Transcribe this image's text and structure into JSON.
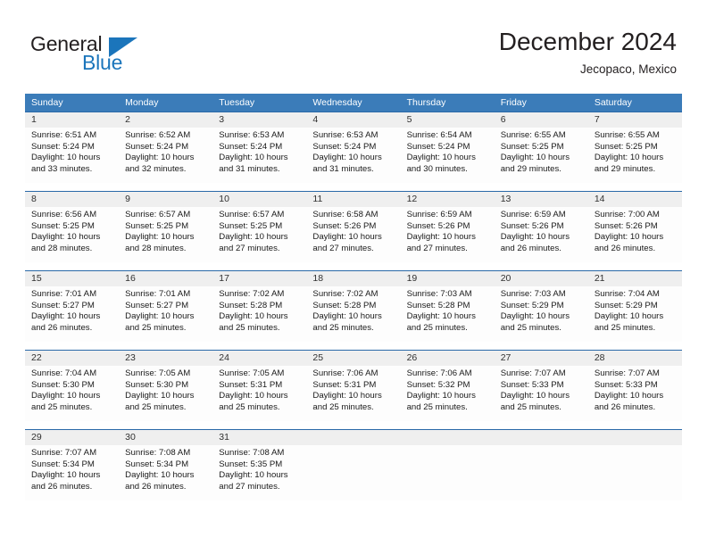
{
  "logo": {
    "part1": "General",
    "part2": "Blue",
    "triangle_color": "#1b75bb"
  },
  "header": {
    "title": "December 2024",
    "subtitle": "Jecopaco, Mexico"
  },
  "theme": {
    "header_row_bg": "#3b7cb9",
    "cell_top_border": "#2a69a8",
    "daynum_band_bg": "#efefef"
  },
  "weekdays": [
    "Sunday",
    "Monday",
    "Tuesday",
    "Wednesday",
    "Thursday",
    "Friday",
    "Saturday"
  ],
  "weeks": [
    [
      {
        "day": "1",
        "sunrise": "Sunrise: 6:51 AM",
        "sunset": "Sunset: 5:24 PM",
        "daylight1": "Daylight: 10 hours",
        "daylight2": "and 33 minutes."
      },
      {
        "day": "2",
        "sunrise": "Sunrise: 6:52 AM",
        "sunset": "Sunset: 5:24 PM",
        "daylight1": "Daylight: 10 hours",
        "daylight2": "and 32 minutes."
      },
      {
        "day": "3",
        "sunrise": "Sunrise: 6:53 AM",
        "sunset": "Sunset: 5:24 PM",
        "daylight1": "Daylight: 10 hours",
        "daylight2": "and 31 minutes."
      },
      {
        "day": "4",
        "sunrise": "Sunrise: 6:53 AM",
        "sunset": "Sunset: 5:24 PM",
        "daylight1": "Daylight: 10 hours",
        "daylight2": "and 31 minutes."
      },
      {
        "day": "5",
        "sunrise": "Sunrise: 6:54 AM",
        "sunset": "Sunset: 5:24 PM",
        "daylight1": "Daylight: 10 hours",
        "daylight2": "and 30 minutes."
      },
      {
        "day": "6",
        "sunrise": "Sunrise: 6:55 AM",
        "sunset": "Sunset: 5:25 PM",
        "daylight1": "Daylight: 10 hours",
        "daylight2": "and 29 minutes."
      },
      {
        "day": "7",
        "sunrise": "Sunrise: 6:55 AM",
        "sunset": "Sunset: 5:25 PM",
        "daylight1": "Daylight: 10 hours",
        "daylight2": "and 29 minutes."
      }
    ],
    [
      {
        "day": "8",
        "sunrise": "Sunrise: 6:56 AM",
        "sunset": "Sunset: 5:25 PM",
        "daylight1": "Daylight: 10 hours",
        "daylight2": "and 28 minutes."
      },
      {
        "day": "9",
        "sunrise": "Sunrise: 6:57 AM",
        "sunset": "Sunset: 5:25 PM",
        "daylight1": "Daylight: 10 hours",
        "daylight2": "and 28 minutes."
      },
      {
        "day": "10",
        "sunrise": "Sunrise: 6:57 AM",
        "sunset": "Sunset: 5:25 PM",
        "daylight1": "Daylight: 10 hours",
        "daylight2": "and 27 minutes."
      },
      {
        "day": "11",
        "sunrise": "Sunrise: 6:58 AM",
        "sunset": "Sunset: 5:26 PM",
        "daylight1": "Daylight: 10 hours",
        "daylight2": "and 27 minutes."
      },
      {
        "day": "12",
        "sunrise": "Sunrise: 6:59 AM",
        "sunset": "Sunset: 5:26 PM",
        "daylight1": "Daylight: 10 hours",
        "daylight2": "and 27 minutes."
      },
      {
        "day": "13",
        "sunrise": "Sunrise: 6:59 AM",
        "sunset": "Sunset: 5:26 PM",
        "daylight1": "Daylight: 10 hours",
        "daylight2": "and 26 minutes."
      },
      {
        "day": "14",
        "sunrise": "Sunrise: 7:00 AM",
        "sunset": "Sunset: 5:26 PM",
        "daylight1": "Daylight: 10 hours",
        "daylight2": "and 26 minutes."
      }
    ],
    [
      {
        "day": "15",
        "sunrise": "Sunrise: 7:01 AM",
        "sunset": "Sunset: 5:27 PM",
        "daylight1": "Daylight: 10 hours",
        "daylight2": "and 26 minutes."
      },
      {
        "day": "16",
        "sunrise": "Sunrise: 7:01 AM",
        "sunset": "Sunset: 5:27 PM",
        "daylight1": "Daylight: 10 hours",
        "daylight2": "and 25 minutes."
      },
      {
        "day": "17",
        "sunrise": "Sunrise: 7:02 AM",
        "sunset": "Sunset: 5:28 PM",
        "daylight1": "Daylight: 10 hours",
        "daylight2": "and 25 minutes."
      },
      {
        "day": "18",
        "sunrise": "Sunrise: 7:02 AM",
        "sunset": "Sunset: 5:28 PM",
        "daylight1": "Daylight: 10 hours",
        "daylight2": "and 25 minutes."
      },
      {
        "day": "19",
        "sunrise": "Sunrise: 7:03 AM",
        "sunset": "Sunset: 5:28 PM",
        "daylight1": "Daylight: 10 hours",
        "daylight2": "and 25 minutes."
      },
      {
        "day": "20",
        "sunrise": "Sunrise: 7:03 AM",
        "sunset": "Sunset: 5:29 PM",
        "daylight1": "Daylight: 10 hours",
        "daylight2": "and 25 minutes."
      },
      {
        "day": "21",
        "sunrise": "Sunrise: 7:04 AM",
        "sunset": "Sunset: 5:29 PM",
        "daylight1": "Daylight: 10 hours",
        "daylight2": "and 25 minutes."
      }
    ],
    [
      {
        "day": "22",
        "sunrise": "Sunrise: 7:04 AM",
        "sunset": "Sunset: 5:30 PM",
        "daylight1": "Daylight: 10 hours",
        "daylight2": "and 25 minutes."
      },
      {
        "day": "23",
        "sunrise": "Sunrise: 7:05 AM",
        "sunset": "Sunset: 5:30 PM",
        "daylight1": "Daylight: 10 hours",
        "daylight2": "and 25 minutes."
      },
      {
        "day": "24",
        "sunrise": "Sunrise: 7:05 AM",
        "sunset": "Sunset: 5:31 PM",
        "daylight1": "Daylight: 10 hours",
        "daylight2": "and 25 minutes."
      },
      {
        "day": "25",
        "sunrise": "Sunrise: 7:06 AM",
        "sunset": "Sunset: 5:31 PM",
        "daylight1": "Daylight: 10 hours",
        "daylight2": "and 25 minutes."
      },
      {
        "day": "26",
        "sunrise": "Sunrise: 7:06 AM",
        "sunset": "Sunset: 5:32 PM",
        "daylight1": "Daylight: 10 hours",
        "daylight2": "and 25 minutes."
      },
      {
        "day": "27",
        "sunrise": "Sunrise: 7:07 AM",
        "sunset": "Sunset: 5:33 PM",
        "daylight1": "Daylight: 10 hours",
        "daylight2": "and 25 minutes."
      },
      {
        "day": "28",
        "sunrise": "Sunrise: 7:07 AM",
        "sunset": "Sunset: 5:33 PM",
        "daylight1": "Daylight: 10 hours",
        "daylight2": "and 26 minutes."
      }
    ],
    [
      {
        "day": "29",
        "sunrise": "Sunrise: 7:07 AM",
        "sunset": "Sunset: 5:34 PM",
        "daylight1": "Daylight: 10 hours",
        "daylight2": "and 26 minutes."
      },
      {
        "day": "30",
        "sunrise": "Sunrise: 7:08 AM",
        "sunset": "Sunset: 5:34 PM",
        "daylight1": "Daylight: 10 hours",
        "daylight2": "and 26 minutes."
      },
      {
        "day": "31",
        "sunrise": "Sunrise: 7:08 AM",
        "sunset": "Sunset: 5:35 PM",
        "daylight1": "Daylight: 10 hours",
        "daylight2": "and 27 minutes."
      },
      {
        "day": "",
        "sunrise": "",
        "sunset": "",
        "daylight1": "",
        "daylight2": ""
      },
      {
        "day": "",
        "sunrise": "",
        "sunset": "",
        "daylight1": "",
        "daylight2": ""
      },
      {
        "day": "",
        "sunrise": "",
        "sunset": "",
        "daylight1": "",
        "daylight2": ""
      },
      {
        "day": "",
        "sunrise": "",
        "sunset": "",
        "daylight1": "",
        "daylight2": ""
      }
    ]
  ]
}
